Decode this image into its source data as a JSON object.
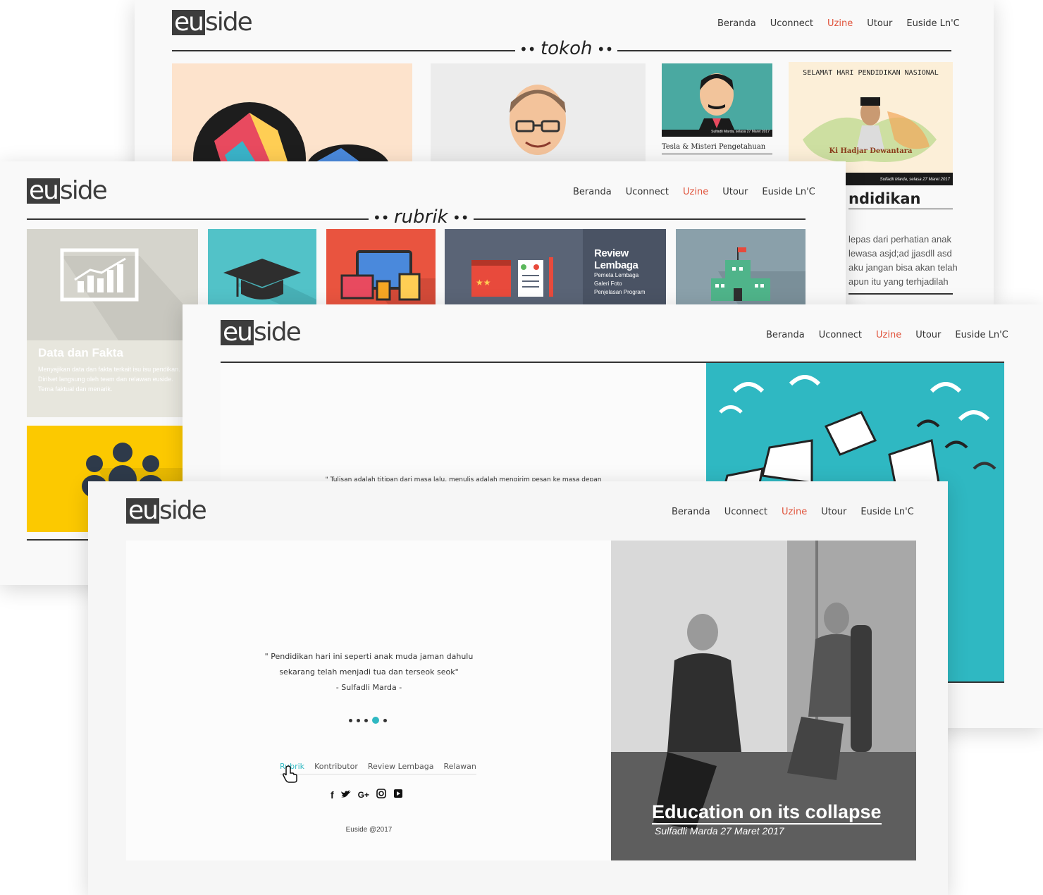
{
  "brand": {
    "logo_box": "eu",
    "logo_rest": "side"
  },
  "nav": [
    "Beranda",
    "Uconnect",
    "Uzine",
    "Utour",
    "Euside Ln'C"
  ],
  "nav_active": "Uzine",
  "colors": {
    "accent": "#e0523a",
    "teal": "#2fb8c2",
    "dark": "#3d3d3d"
  },
  "card1": {
    "section": "tokoh",
    "thumb3_caption": "Tesla & Misteri Pengetahuan",
    "thumb3_meta": "Sulfadli Marda, selasa 27 Maret 2017",
    "thumb4_title": "SELAMAT HARI PENDIDIKAN NASIONAL",
    "thumb4_name": "Ki Hadjar Dewantara",
    "thumb4_meta": "Sulfadli Marda, selasa 27 Maret 2017",
    "side_title": "ndidikan",
    "side_text": [
      "lepas dari perhatian anak",
      "lewasa asjd;ad jjasdll asd",
      "aku jangan bisa akan telah",
      "apun itu yang terhjadilah"
    ]
  },
  "card2": {
    "section": "rubrik",
    "tile1_title": "Data dan Fakta",
    "tile1_desc": [
      "Menyajikan data dan fakta terkait isu isu pendikan.",
      "Dirilset langsung oleh team dan relawan euside.",
      "Tema faktual dan menarik."
    ],
    "tile4_title": "Review Lembaga",
    "tile4_items": [
      "Pemeta Lembaga",
      "Galeri Foto",
      "Penjelasan Program"
    ]
  },
  "card3": {
    "quote_partial": "\" Tulisan adalah titipan dari masa lalu, menulis adalah mengirim pesan ke masa depan"
  },
  "card4": {
    "quote_lines": [
      "\" Pendidikan hari ini seperti anak muda jaman dahulu",
      "sekarang telah menjadi tua dan terseok seok\"",
      "- Sulfadli Marda -"
    ],
    "footer_links": [
      "Rubrik",
      "Kontributor",
      "Review Lembaga",
      "Relawan"
    ],
    "social_icons": [
      "facebook-icon",
      "twitter-icon",
      "google-plus-icon",
      "instagram-icon",
      "youtube-icon"
    ],
    "copyright": "Euside @2017",
    "hero_title": "Education on its collapse",
    "hero_meta": "Sulfadli Marda 27 Maret 2017"
  }
}
